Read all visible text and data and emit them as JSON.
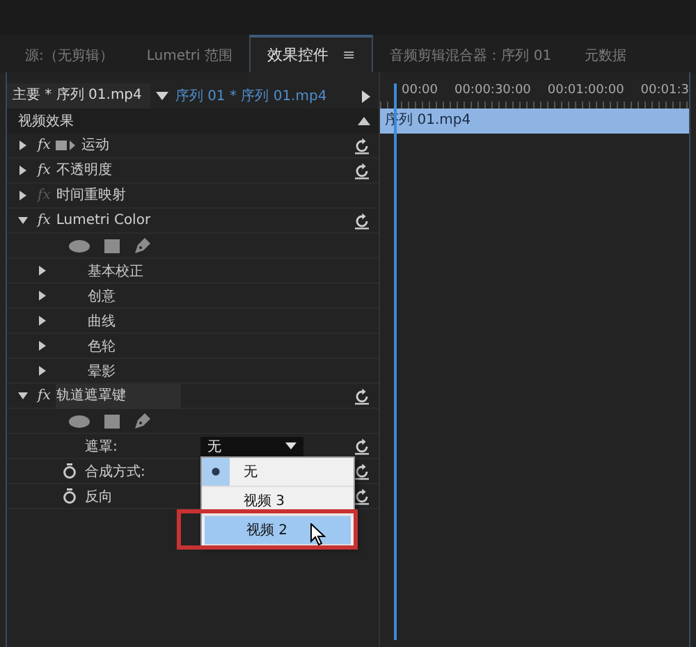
{
  "tabs": [
    {
      "label": "源:（无剪辑）",
      "selected": false
    },
    {
      "label": "Lumetri 范围",
      "selected": false
    },
    {
      "label": "效果控件",
      "selected": true,
      "menu": "≡"
    },
    {
      "label": "音频剪辑混合器：序列 01",
      "selected": false
    },
    {
      "label": "元数据",
      "selected": false
    }
  ],
  "header": {
    "master_clip": "主要 * 序列 01.mp4",
    "sequence_clip": "序列 01 * 序列 01.mp4"
  },
  "section_title": "视频效果",
  "effects": [
    {
      "kind": "effect",
      "fx": "fx",
      "label": "运动",
      "expanded": false,
      "fx_enabled": true,
      "motion_icon": true,
      "resettable": true,
      "selected": false
    },
    {
      "kind": "effect",
      "fx": "fx",
      "label": "不透明度",
      "expanded": false,
      "fx_enabled": true,
      "resettable": true,
      "selected": false
    },
    {
      "kind": "effect",
      "fx": "fx",
      "label": "时间重映射",
      "expanded": false,
      "fx_enabled": false,
      "resettable": false,
      "selected": false
    },
    {
      "kind": "effect",
      "fx": "fx",
      "label": "Lumetri Color",
      "expanded": true,
      "fx_enabled": true,
      "resettable": true,
      "selected": false,
      "children": [
        {
          "kind": "shapes"
        },
        {
          "kind": "group",
          "label": "基本校正",
          "expanded": false
        },
        {
          "kind": "group",
          "label": "创意",
          "expanded": false
        },
        {
          "kind": "group",
          "label": "曲线",
          "expanded": false
        },
        {
          "kind": "group",
          "label": "色轮",
          "expanded": false
        },
        {
          "kind": "group",
          "label": "晕影",
          "expanded": false
        }
      ]
    },
    {
      "kind": "effect",
      "fx": "fx",
      "label": "轨道遮罩键",
      "expanded": true,
      "fx_enabled": true,
      "resettable": true,
      "selected": true,
      "children": [
        {
          "kind": "shapes"
        },
        {
          "kind": "dropdown",
          "label": "遮罩:",
          "value": "无",
          "resettable": true,
          "open": true,
          "options": [
            {
              "label": "无",
              "selected": true,
              "hovered": false,
              "annotated": false
            },
            {
              "label": "视频 3",
              "selected": false,
              "hovered": false,
              "annotated": false
            },
            {
              "label": "视频 2",
              "selected": false,
              "hovered": true,
              "annotated": true
            }
          ]
        },
        {
          "kind": "param",
          "label": "合成方式:",
          "animatable": true,
          "resettable": true
        },
        {
          "kind": "param",
          "label": "反向",
          "animatable": true,
          "resettable": true
        }
      ]
    }
  ],
  "timeline": {
    "ticks": [
      "00:00",
      "00:00:30:00",
      "00:01:00:00",
      "00:01:3"
    ],
    "clip": "序列 01.mp4"
  }
}
